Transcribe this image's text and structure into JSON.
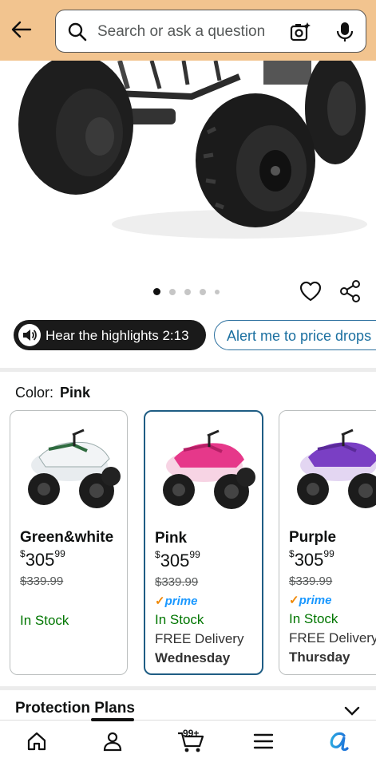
{
  "search": {
    "placeholder": "Search or ask a question"
  },
  "gallery": {
    "image_count": 5,
    "active_index": 0
  },
  "pills": {
    "hear_label": "Hear the highlights 2:13",
    "alert_label": "Alert me to price drops"
  },
  "color": {
    "label": "Color:",
    "selected": "Pink"
  },
  "variants": [
    {
      "name": "Green&white",
      "price_whole": "305",
      "price_fraction": "99",
      "list_price": "$339.99",
      "prime": false,
      "stock": "In Stock",
      "delivery": "",
      "delivery_day": ""
    },
    {
      "name": "Pink",
      "price_whole": "305",
      "price_fraction": "99",
      "list_price": "$339.99",
      "prime": true,
      "prime_label": "prime",
      "stock": "In Stock",
      "delivery": "FREE Delivery",
      "delivery_day": "Wednesday"
    },
    {
      "name": "Purple",
      "price_whole": "305",
      "price_fraction": "99",
      "list_price": "$339.99",
      "prime": true,
      "prime_label": "prime",
      "stock": "In Stock",
      "delivery": "FREE Delivery",
      "delivery_day": "Thursday"
    }
  ],
  "currency_symbol": "$",
  "protection": {
    "title": "Protection Plans"
  },
  "nav": {
    "cart_count": "99+",
    "items": [
      "home-icon",
      "account-icon",
      "cart-icon",
      "menu-icon",
      "rufus-icon"
    ]
  },
  "colors": {
    "topbar": "#f2c48f",
    "selected_border": "#1f5d84",
    "stock_green": "#007600",
    "prime_blue": "#1a98ff"
  }
}
